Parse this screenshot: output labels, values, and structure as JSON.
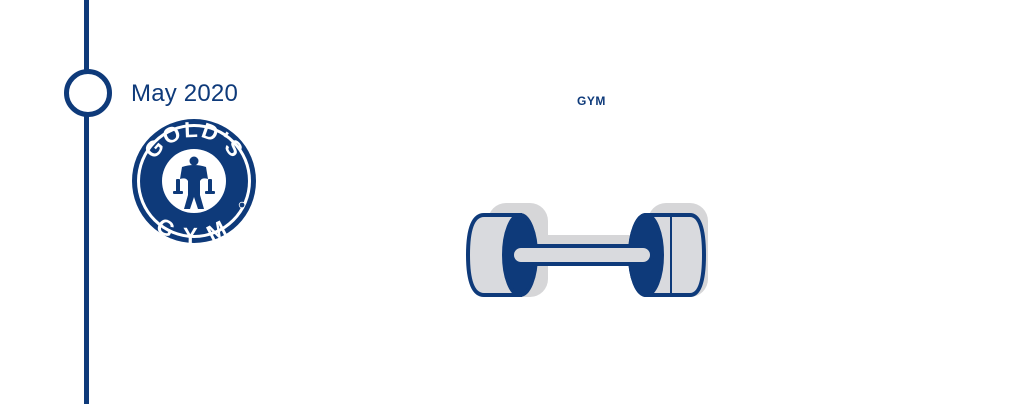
{
  "timeline": {
    "date": "May 2020"
  },
  "entry": {
    "category": "GYM",
    "logo": {
      "brand": "GOLD'S GYM",
      "icon": "golds-gym-logo"
    },
    "illustration": {
      "icon": "dumbbell-icon"
    }
  },
  "colors": {
    "primary": "#0e3a7a",
    "shadow": "#d6d6d8",
    "plate": "#d9dade",
    "background": "#ffffff"
  }
}
